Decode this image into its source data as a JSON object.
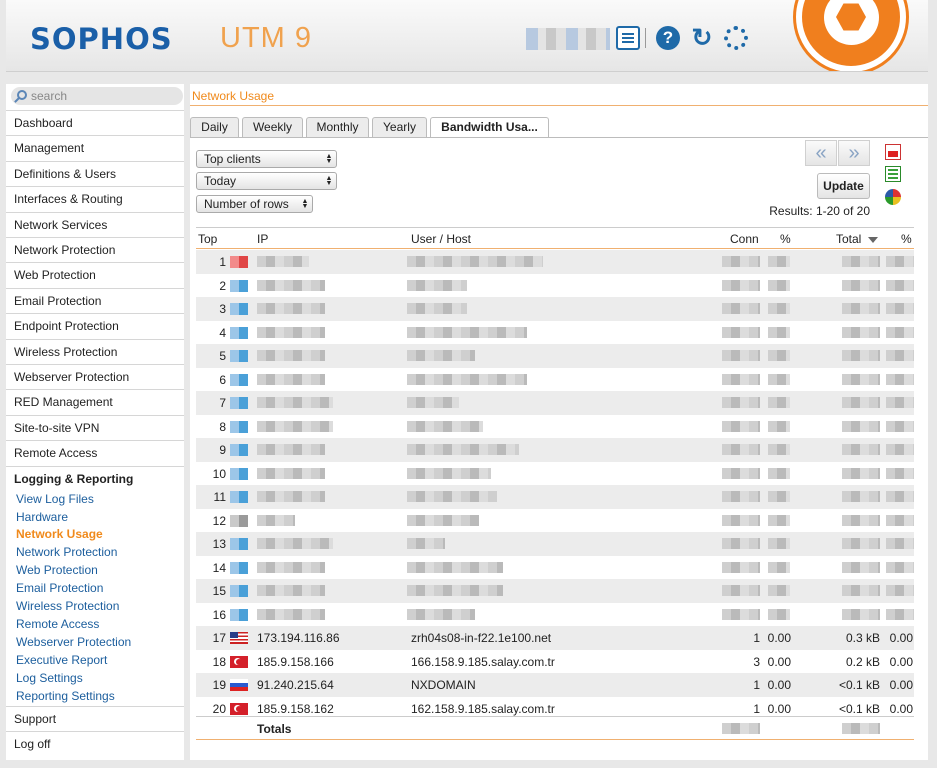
{
  "header": {
    "logo": "SOPHOS",
    "product": "UTM 9",
    "icons": [
      "clipboard-icon",
      "help-icon",
      "reload-icon",
      "spinner-icon"
    ]
  },
  "sidebar": {
    "search_placeholder": "search",
    "items_top": [
      "Dashboard",
      "Management",
      "Definitions & Users",
      "Interfaces & Routing",
      "Network Services",
      "Network Protection",
      "Web Protection",
      "Email Protection",
      "Endpoint Protection",
      "Wireless Protection",
      "Webserver Protection",
      "RED Management",
      "Site-to-site VPN",
      "Remote Access"
    ],
    "section": "Logging & Reporting",
    "sub_items": [
      "View Log Files",
      "Hardware",
      "Network Usage",
      "Network Protection",
      "Web Protection",
      "Email Protection",
      "Wireless Protection",
      "Remote Access",
      "Webserver Protection",
      "Executive Report",
      "Log Settings",
      "Reporting Settings"
    ],
    "active_sub": "Network Usage",
    "items_bottom": [
      "Support",
      "Log off"
    ]
  },
  "main": {
    "breadcrumb": "Network Usage",
    "tabs": [
      "Daily",
      "Weekly",
      "Monthly",
      "Yearly",
      "Bandwidth Usa..."
    ],
    "active_tab": "Bandwidth Usa...",
    "selects": [
      "Top clients",
      "Today",
      "Number of rows"
    ],
    "pager": {
      "prev": "«",
      "next": "»"
    },
    "update_label": "Update",
    "results": "Results: 1-20 of 20",
    "columns": [
      "Top",
      "IP",
      "User / Host",
      "Conn",
      "%",
      "Total",
      "%"
    ],
    "rows": [
      {
        "top": "1"
      },
      {
        "top": "2"
      },
      {
        "top": "3"
      },
      {
        "top": "4"
      },
      {
        "top": "5"
      },
      {
        "top": "6"
      },
      {
        "top": "7"
      },
      {
        "top": "8"
      },
      {
        "top": "9"
      },
      {
        "top": "10"
      },
      {
        "top": "11"
      },
      {
        "top": "12"
      },
      {
        "top": "13"
      },
      {
        "top": "14"
      },
      {
        "top": "15"
      },
      {
        "top": "16"
      },
      {
        "top": "17",
        "ip": "173.194.116.86",
        "host": "zrh04s08-in-f22.1e100.net",
        "conn": "1",
        "pct": "0.00",
        "total": "0.3 kB",
        "pct2": "0.00"
      },
      {
        "top": "18",
        "ip": "185.9.158.166",
        "host": "166.158.9.185.salay.com.tr",
        "conn": "3",
        "pct": "0.00",
        "total": "0.2 kB",
        "pct2": "0.00"
      },
      {
        "top": "19",
        "ip": "91.240.215.64",
        "host": "NXDOMAIN",
        "conn": "1",
        "pct": "0.00",
        "total": "<0.1 kB",
        "pct2": "0.00"
      },
      {
        "top": "20",
        "ip": "185.9.158.162",
        "host": "162.158.9.185.salay.com.tr",
        "conn": "1",
        "pct": "0.00",
        "total": "<0.1 kB",
        "pct2": "0.00"
      }
    ],
    "totals_label": "Totals"
  }
}
